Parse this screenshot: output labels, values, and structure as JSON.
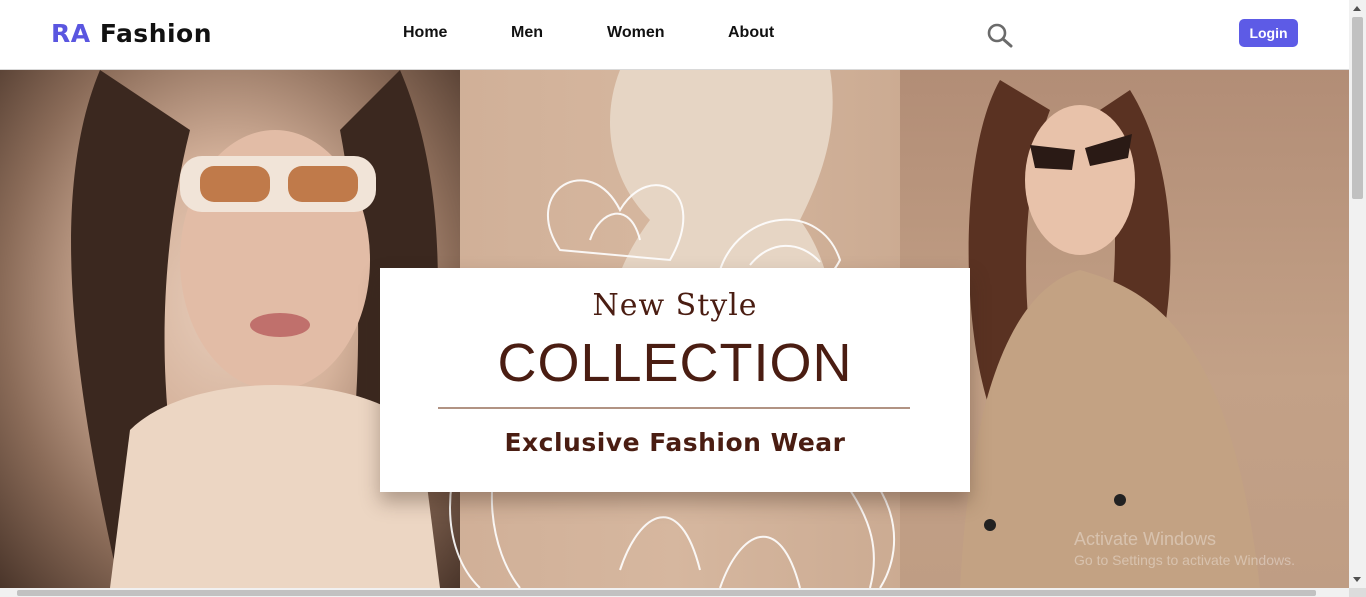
{
  "brand": {
    "prefix": "RA",
    "name": "Fashion",
    "prefix_color": "#5a56e0"
  },
  "nav": {
    "items": [
      {
        "label": "Home"
      },
      {
        "label": "Men"
      },
      {
        "label": "Women"
      },
      {
        "label": "About"
      }
    ]
  },
  "search": {
    "icon": "search-icon"
  },
  "login": {
    "label": "Login",
    "color": "#5d5be6"
  },
  "hero": {
    "script": "New Style",
    "title": "COLLECTION",
    "subtitle": "Exclusive Fashion Wear",
    "text_color": "#4a1d12"
  },
  "watermark": {
    "title": "Activate Windows",
    "subtitle": "Go to Settings to activate Windows."
  }
}
